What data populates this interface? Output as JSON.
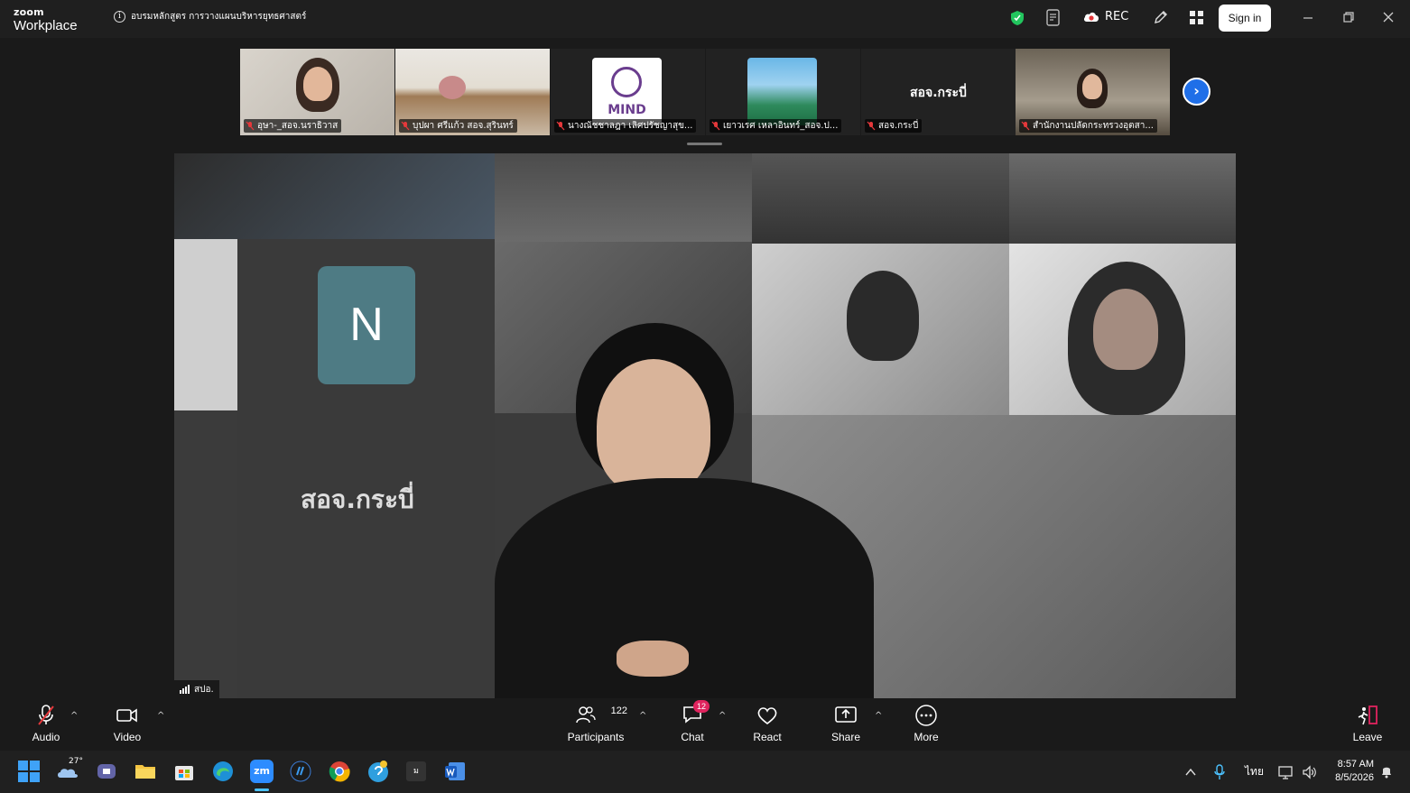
{
  "app": {
    "logo_top": "zoom",
    "logo_bottom": "Workplace",
    "meeting_title": "อบรมหลักสูตร การวางแผนบริหารยุทธศาสตร์",
    "rec_label": "REC",
    "sign_in_label": "Sign in"
  },
  "gallery": {
    "participants": [
      {
        "name": "อุษา-_สอจ.นราธิวาส"
      },
      {
        "name": "บุปผา ศรีแก้ว สอจ.สุรินทร์"
      },
      {
        "name": "นางณัชชาลฎา เลิศปรัชญาสุข...",
        "badge_text": "MIND"
      },
      {
        "name": "เยาวเรศ เหลาอินทร์_สอจ.ป..."
      },
      {
        "name": "สอจ.กระบี่",
        "center_label": "สอจ.กระบี่"
      },
      {
        "name": "สำนักงานปลัดกระทรวงอุตสา..."
      }
    ],
    "next_icon": "chevron-right-icon"
  },
  "main_video": {
    "n_tile_letter": "N",
    "krabi_label": "สอจ.กระบี่",
    "speaker_tag": "สปอ."
  },
  "controls": {
    "audio": "Audio",
    "video": "Video",
    "participants": "Participants",
    "participants_count": "122",
    "chat": "Chat",
    "chat_badge": "12",
    "react": "React",
    "share": "Share",
    "more": "More",
    "leave": "Leave"
  },
  "taskbar": {
    "weather_temp": "27°",
    "lang": "ไทย",
    "time": "8:57 AM",
    "date": "8/5/2026"
  },
  "colors": {
    "accent": "#1f6fe8",
    "leave_red": "#e0245e",
    "mic_off_red": "#e5383b",
    "shield_green": "#22c55e"
  }
}
